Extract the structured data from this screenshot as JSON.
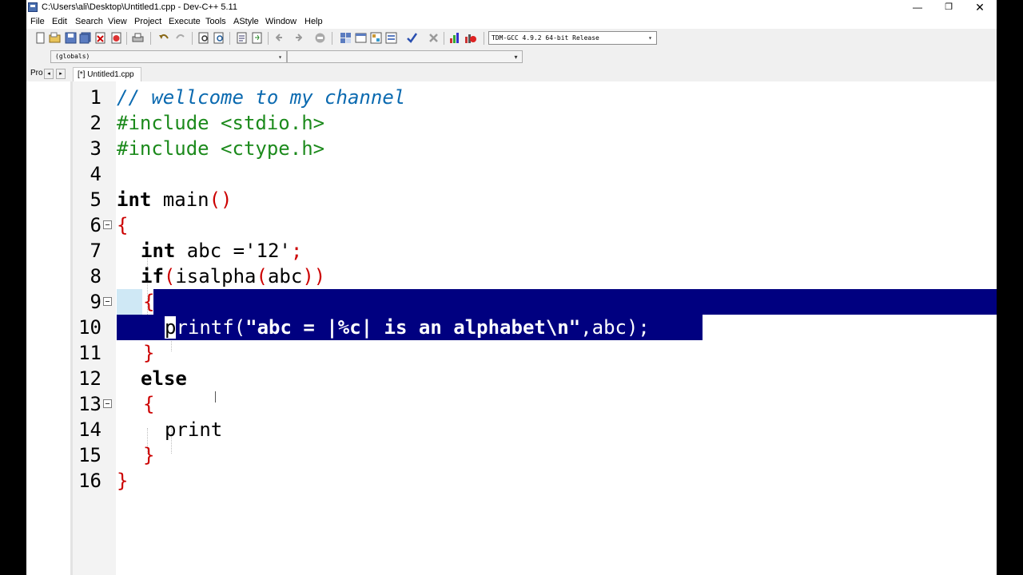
{
  "window": {
    "title": "C:\\Users\\ali\\Desktop\\Untitled1.cpp - Dev-C++ 5.11",
    "controls": {
      "minimize": "—",
      "restore": "❐",
      "close": "✕"
    }
  },
  "menu": {
    "items": [
      "File",
      "Edit",
      "Search",
      "View",
      "Project",
      "Execute",
      "Tools",
      "AStyle",
      "Window",
      "Help"
    ]
  },
  "toolbar": {
    "compiler": "TDM-GCC 4.9.2 64-bit Release",
    "scope": "(globals)",
    "dropdown_arrow": "▾"
  },
  "tabs": {
    "project_panel": "Pro",
    "scroll_left": "◂",
    "scroll_right": "▸",
    "file": "[*] Untitled1.cpp"
  },
  "editor": {
    "line_numbers": [
      "1",
      "2",
      "3",
      "4",
      "5",
      "6",
      "7",
      "8",
      "9",
      "10",
      "11",
      "12",
      "13",
      "14",
      "15",
      "16"
    ],
    "lines": [
      {
        "comment": "// wellcome to my channel"
      },
      {
        "pre": "#include <stdio.h>"
      },
      {
        "pre": "#include <ctype.h>"
      },
      {
        "text": ""
      },
      {
        "kw": "int",
        "rest": " main",
        "sym": "()"
      },
      {
        "sym": "{"
      },
      {
        "kw": "int",
        "rest": " abc =",
        "str": "'12'",
        "sym": ";"
      },
      {
        "kw": "if",
        "sym1": "(",
        "rest": "isalpha",
        "sym2": "(",
        "rest2": "abc",
        "sym3": "))"
      },
      {
        "sym": "{"
      },
      {
        "pre_text": "p",
        "sel_text": "rintf(",
        "sel_bold": "\"abc = |%c| is an alphabet\\n\"",
        "sel_tail": ",abc);"
      },
      {
        "sym": "}"
      },
      {
        "kw": "else"
      },
      {
        "sym": "{"
      },
      {
        "rest": "print"
      },
      {
        "sym": "}"
      },
      {
        "sym": "}"
      }
    ]
  }
}
